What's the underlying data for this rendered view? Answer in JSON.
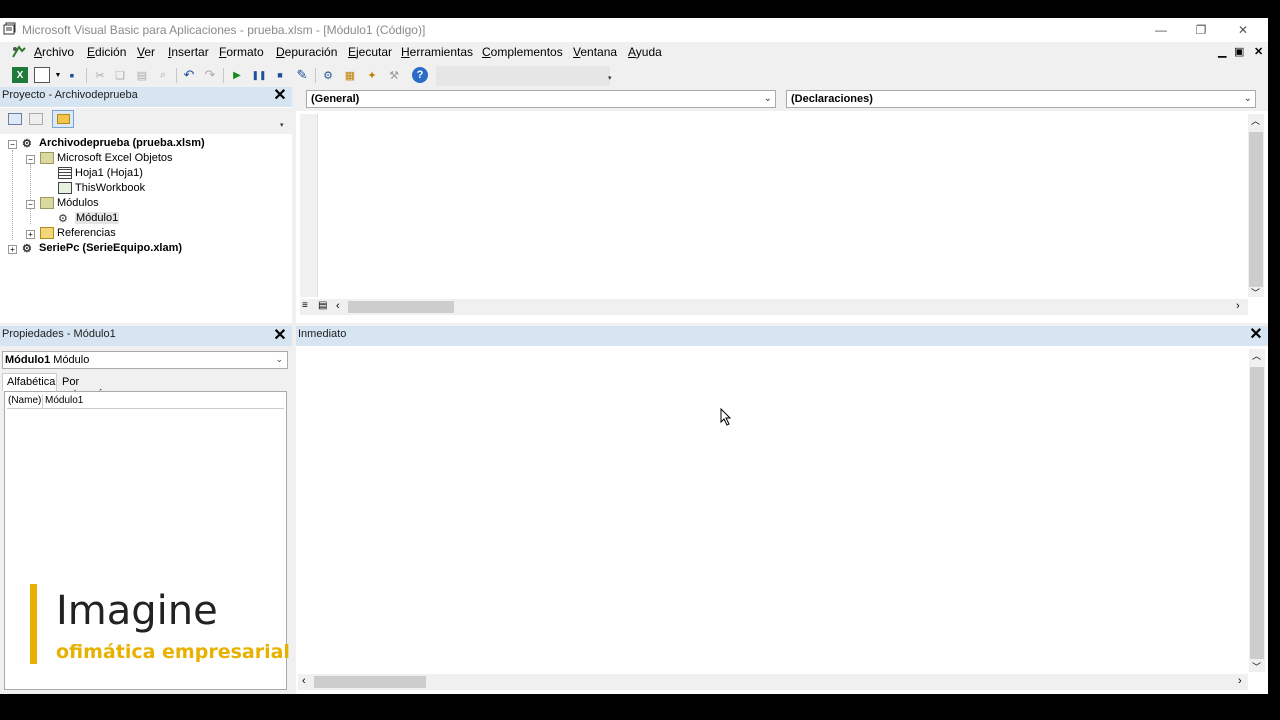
{
  "window": {
    "title": "Microsoft Visual Basic para Aplicaciones - prueba.xlsm - [Módulo1 (Código)]",
    "minimize": "—",
    "restore": "❐",
    "close": "✕"
  },
  "menu": [
    "Archivo",
    "Edición",
    "Ver",
    "Insertar",
    "Formato",
    "Depuración",
    "Ejecutar",
    "Herramientas",
    "Complementos",
    "Ventana",
    "Ayuda"
  ],
  "mdi_controls": {
    "minimize": "▁",
    "restore": "▣",
    "close": "✕"
  },
  "project": {
    "title": "Proyecto - Archivodeprueba",
    "close": "✕",
    "tree": [
      {
        "label": "Archivodeprueba (prueba.xlsm)",
        "icon": "vba-project-icon"
      },
      {
        "label": "Microsoft Excel Objetos",
        "icon": "folder-open-icon"
      },
      {
        "label": "Hoja1 (Hoja1)",
        "icon": "sheet-icon"
      },
      {
        "label": "ThisWorkbook",
        "icon": "workbook-icon"
      },
      {
        "label": "Módulos",
        "icon": "folder-open-icon"
      },
      {
        "label": "Módulo1",
        "icon": "module-icon"
      },
      {
        "label": "Referencias",
        "icon": "folder-icon"
      },
      {
        "label": "SeriePc (SerieEquipo.xlam)",
        "icon": "vba-project-icon"
      }
    ]
  },
  "properties": {
    "title": "Propiedades - Módulo1",
    "close": "✕",
    "object_name": "Módulo1",
    "object_type": "Módulo",
    "tabs": [
      "Alfabética",
      "Por categorías"
    ],
    "rows": [
      {
        "name": "(Name)",
        "value": "Módulo1"
      }
    ]
  },
  "code": {
    "object_combo": "(General)",
    "procedure_combo": "(Declaraciones)"
  },
  "immediate": {
    "title": "Inmediato",
    "close": "✕"
  },
  "brand": {
    "name": "Imagine",
    "tagline": "ofimática empresarial",
    "accent": "#e8b100"
  }
}
